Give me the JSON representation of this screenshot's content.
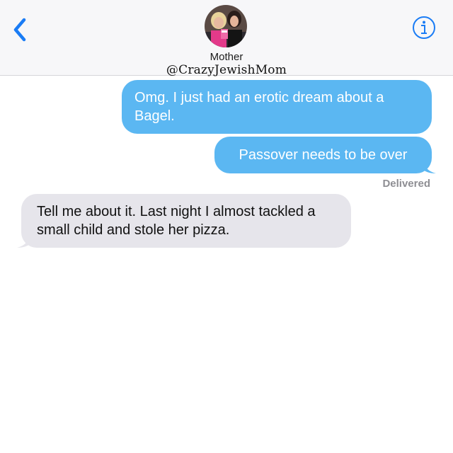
{
  "header": {
    "contact_name": "Mother",
    "watermark": "@CrazyJewishMom",
    "back_icon": "chevron-left-icon",
    "info_icon": "info-icon",
    "accent_color": "#1a7cf5"
  },
  "messages": [
    {
      "direction": "outgoing",
      "text": "Omg. I just had an erotic dream about a Bagel."
    },
    {
      "direction": "outgoing",
      "text": "Passover needs to be over"
    },
    {
      "direction": "incoming",
      "text": "Tell me about it. Last night I almost tackled a small child and stole her pizza."
    }
  ],
  "status": {
    "delivered": "Delivered"
  },
  "colors": {
    "outgoing_bubble": "#5bb7f2",
    "incoming_bubble": "#e6e5eb"
  }
}
